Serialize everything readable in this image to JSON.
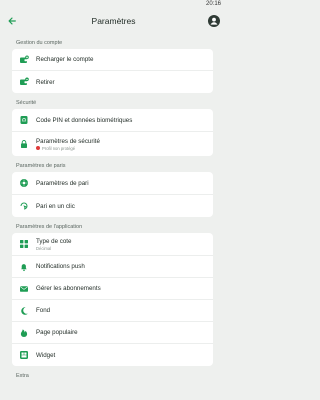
{
  "status_bar": {
    "time": "20:16"
  },
  "app_bar": {
    "title": "Paramètres"
  },
  "accent_color": "#1f9d55",
  "sections": {
    "account": {
      "title": "Gestion du compte",
      "items": [
        {
          "label": "Recharger le compte",
          "icon": "wallet-plus-icon"
        },
        {
          "label": "Retirer",
          "icon": "wallet-minus-icon"
        }
      ]
    },
    "security": {
      "title": "Sécurité",
      "items": [
        {
          "label": "Code PIN et données biométriques",
          "icon": "fingerprint-icon"
        },
        {
          "label": "Paramètres de sécurité",
          "icon": "lock-icon",
          "warning": "Profil non protégé"
        }
      ]
    },
    "bets": {
      "title": "Paramètres de paris",
      "items": [
        {
          "label": "Paramètres de pari",
          "icon": "coupon-settings-icon"
        },
        {
          "label": "Pari en un clic",
          "icon": "one-click-icon"
        }
      ]
    },
    "app": {
      "title": "Paramètres de l'application",
      "items": [
        {
          "label": "Type de cote",
          "icon": "grid-icon",
          "sub": "Décimal"
        },
        {
          "label": "Notifications push",
          "icon": "bell-icon"
        },
        {
          "label": "Gérer les abonnements",
          "icon": "mail-icon"
        },
        {
          "label": "Fond",
          "icon": "moon-icon"
        },
        {
          "label": "Page populaire",
          "icon": "flame-icon"
        },
        {
          "label": "Widget",
          "icon": "widget-icon"
        }
      ]
    },
    "extra": {
      "title": "Extra"
    }
  }
}
